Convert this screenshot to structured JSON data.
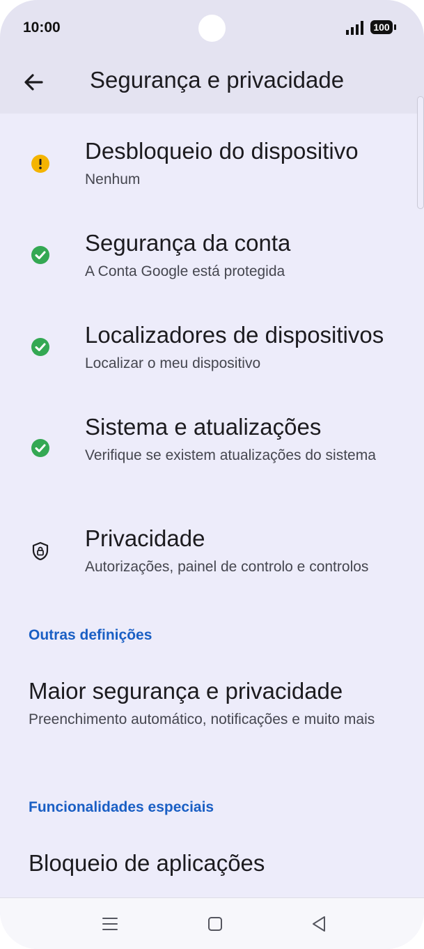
{
  "status": {
    "time": "10:00",
    "battery": "100"
  },
  "header": {
    "title": "Segurança e privacidade"
  },
  "items": [
    {
      "title": "Desbloqueio do dispositivo",
      "subtitle": "Nenhum",
      "icon": "warning-icon"
    },
    {
      "title": "Segurança da conta",
      "subtitle": "A Conta Google está protegida",
      "icon": "check-icon"
    },
    {
      "title": "Localizadores de dispositivos",
      "subtitle": "Localizar o meu dispositivo",
      "icon": "check-icon"
    },
    {
      "title": "Sistema e atualizações",
      "subtitle": "Verifique se existem atualizações do sistema",
      "icon": "check-icon"
    },
    {
      "title": "Privacidade",
      "subtitle": "Autorizações, painel de controlo e controlos",
      "icon": "shield-lock-icon"
    }
  ],
  "sections": {
    "other": {
      "label": "Outras definições",
      "item": {
        "title": "Maior segurança e privacidade",
        "subtitle": "Preenchimento automático, notificações e muito mais"
      }
    },
    "special": {
      "label": "Funcionalidades especiais",
      "item": {
        "title": "Bloqueio de aplicações"
      }
    }
  },
  "colors": {
    "warning": "#f4b400",
    "ok": "#34a853",
    "accent": "#1a5fc4",
    "background": "#edecfa"
  }
}
